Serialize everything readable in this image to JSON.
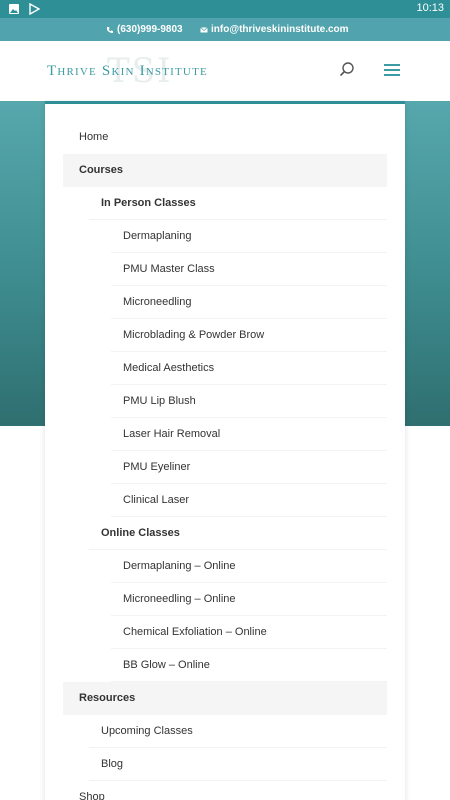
{
  "status_bar": {
    "time": "10:13",
    "icons": [
      "image-icon",
      "play-store-icon"
    ]
  },
  "topbar": {
    "phone": "(630)999-9803",
    "email": "info@thriveskininstitute.com"
  },
  "header": {
    "logo_monogram": "TSI",
    "logo_text": "Thrive Skin Institute"
  },
  "menu": {
    "items": [
      {
        "label": "Home",
        "level": 0,
        "bold": false
      },
      {
        "label": "Courses",
        "level": 0,
        "bold": true
      },
      {
        "label": "In Person Classes",
        "level": 1,
        "bold": true
      },
      {
        "label": "Dermaplaning",
        "level": 2,
        "bold": false
      },
      {
        "label": "PMU Master Class",
        "level": 2,
        "bold": false
      },
      {
        "label": "Microneedling",
        "level": 2,
        "bold": false
      },
      {
        "label": "Microblading & Powder Brow",
        "level": 2,
        "bold": false
      },
      {
        "label": "Medical Aesthetics",
        "level": 2,
        "bold": false
      },
      {
        "label": "PMU Lip Blush",
        "level": 2,
        "bold": false
      },
      {
        "label": "Laser Hair Removal",
        "level": 2,
        "bold": false
      },
      {
        "label": "PMU Eyeliner",
        "level": 2,
        "bold": false
      },
      {
        "label": "Clinical Laser",
        "level": 2,
        "bold": false
      },
      {
        "label": "Online Classes",
        "level": 1,
        "bold": true
      },
      {
        "label": "Dermaplaning – Online",
        "level": 2,
        "bold": false
      },
      {
        "label": "Microneedling – Online",
        "level": 2,
        "bold": false
      },
      {
        "label": "Chemical Exfoliation – Online",
        "level": 2,
        "bold": false
      },
      {
        "label": "BB Glow – Online",
        "level": 2,
        "bold": false
      },
      {
        "label": "Resources",
        "level": 0,
        "bold": true
      },
      {
        "label": "Upcoming Classes",
        "level": 1,
        "bold": false
      },
      {
        "label": "Blog",
        "level": 1,
        "bold": false
      },
      {
        "label": "Shop",
        "level": 0,
        "bold": false
      }
    ]
  },
  "colors": {
    "accent": "#2e8f96",
    "topbar": "#51a3ad",
    "brand_text": "#3c9ba3"
  }
}
